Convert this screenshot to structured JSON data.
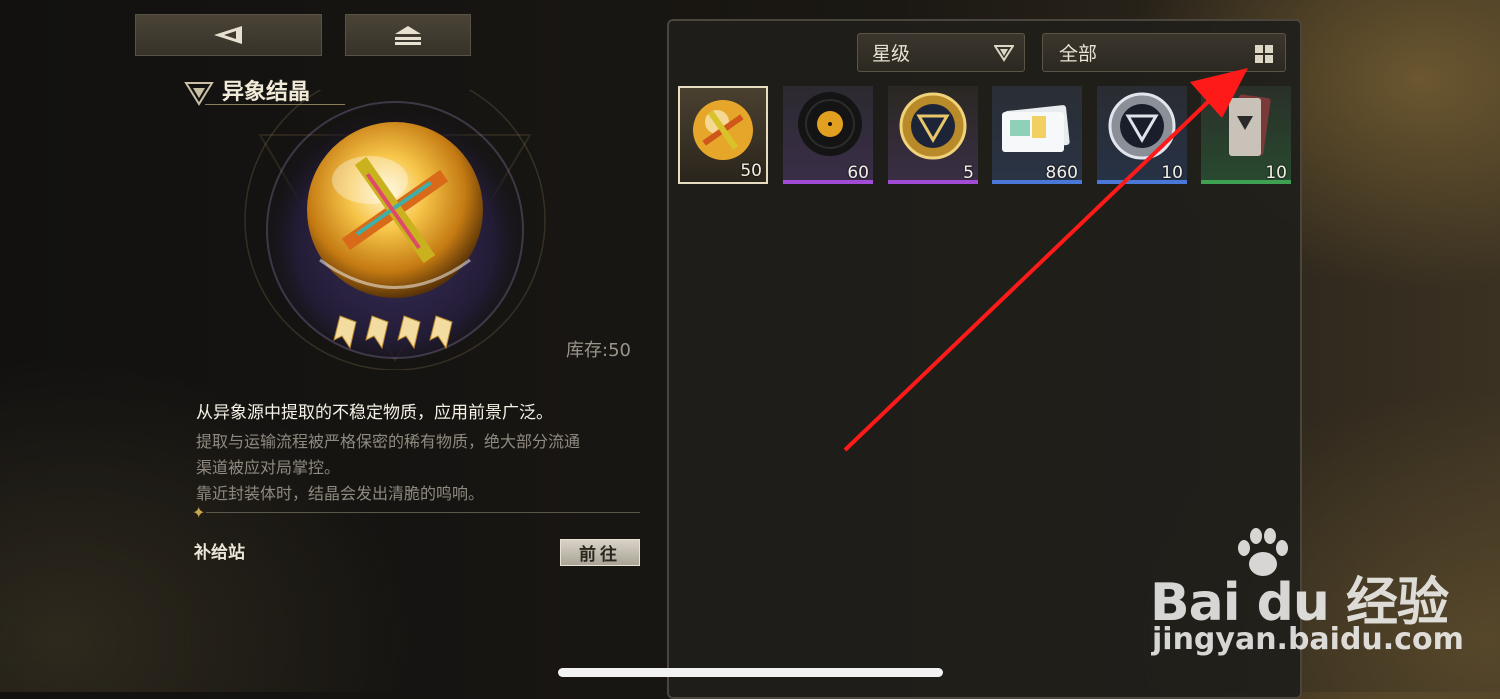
{
  "item": {
    "name": "异象结晶",
    "stock": "库存:50",
    "description_main": "从异象源中提取的不稳定物质，应用前景广泛。",
    "description_lines": [
      "提取与运输流程被严格保密的稀有物质，绝大部分流通",
      "渠道被应对局掌控。",
      "靠近封装体时，结晶会发出清脆的鸣响。"
    ],
    "stars": 4
  },
  "source": {
    "label": "补给站",
    "goto_label": "前往"
  },
  "filters": {
    "rarity_label": "星级",
    "category_label": "全部"
  },
  "inventory": [
    {
      "icon": "crystal-orb-icon",
      "count": "50",
      "rarity_color": "#8a7a5a",
      "selected": true
    },
    {
      "icon": "vinyl-record-icon",
      "count": "60",
      "rarity_color": "#a24bd6",
      "selected": false
    },
    {
      "icon": "gold-emblem-badge-icon",
      "count": "5",
      "rarity_color": "#a24bd6",
      "selected": false
    },
    {
      "icon": "ticket-cards-icon",
      "count": "860",
      "rarity_color": "#4a78d8",
      "selected": false
    },
    {
      "icon": "silver-emblem-badge-icon",
      "count": "10",
      "rarity_color": "#4a78d8",
      "selected": false
    },
    {
      "icon": "green-card-pack-icon",
      "count": "10",
      "rarity_color": "#3fa152",
      "selected": false
    }
  ],
  "watermark": {
    "logo": "Bai du 经验",
    "url": "jingyan.baidu.com"
  },
  "colors": {
    "accent_gold": "#c8a54e",
    "annotation_arrow": "#ff1a1a"
  }
}
